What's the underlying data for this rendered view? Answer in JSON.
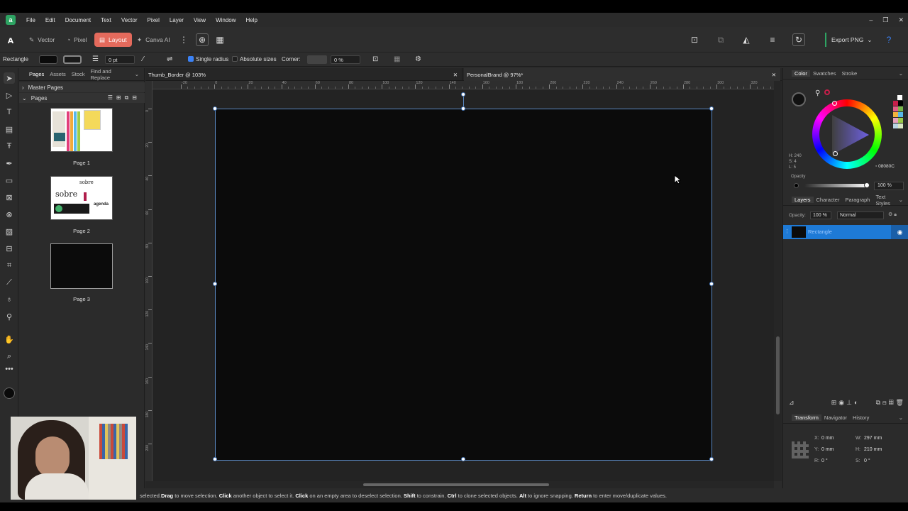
{
  "app": {
    "logo_letter": "a",
    "accent": "#2ea463"
  },
  "menu": [
    "File",
    "Edit",
    "Document",
    "Text",
    "Vector",
    "Pixel",
    "Layer",
    "View",
    "Window",
    "Help"
  ],
  "window_controls": {
    "minimize": "–",
    "restore": "❐",
    "close": "✕"
  },
  "personas": {
    "vector": "Vector",
    "pixel": "Pixel",
    "layout": "Layout",
    "canva": "Canva AI"
  },
  "export_label": "Export PNG",
  "context": {
    "tool_name": "Rectangle",
    "stroke_width": "0 pt",
    "single_radius": "Single radius",
    "absolute_sizes": "Absolute sizes",
    "corner_label": "Corner:",
    "corner_value": "0 %"
  },
  "pages_panel": {
    "tabs": [
      "Pages",
      "Assets",
      "Stock",
      "Find and Replace"
    ],
    "master_pages": "Master Pages",
    "pages_header": "Pages",
    "pages": [
      "Page 1",
      "Page 2",
      "Page 3"
    ],
    "page2_words": {
      "a": "sobre",
      "b": "sobre",
      "c": "agenda"
    }
  },
  "doc_tabs": [
    "Thumb_Border @ 103%",
    "PersonalBrand @ 97%*"
  ],
  "ruler_labels": [
    "-20",
    "0",
    "20",
    "40",
    "60",
    "80",
    "100",
    "120",
    "140",
    "160",
    "180",
    "200",
    "220",
    "240",
    "260",
    "280",
    "300",
    "320"
  ],
  "vruler_labels": [
    "0",
    "20",
    "40",
    "60",
    "80",
    "100",
    "120",
    "140",
    "160",
    "180",
    "200"
  ],
  "color_panel": {
    "tabs": [
      "Color",
      "Swatches",
      "Stroke"
    ],
    "hsl": {
      "h": "H: 240",
      "s": "S: 4",
      "l": "L: 5"
    },
    "hex": "08080C",
    "opacity_label": "Opacity",
    "opacity_value": "100 %"
  },
  "layers_panel": {
    "tabs": [
      "Layers",
      "Character",
      "Paragraph",
      "Text Styles"
    ],
    "opacity_label": "Opacity:",
    "opacity_value": "100 %",
    "blend_mode": "Normal",
    "layer_name": "Rectangle"
  },
  "transform_panel": {
    "tabs": [
      "Transform",
      "Navigator",
      "History"
    ],
    "x_label": "X:",
    "x": "0 mm",
    "y_label": "Y:",
    "y": "0 mm",
    "w_label": "W:",
    "w": "297 mm",
    "h_label": "H:",
    "h": "210 mm",
    "r_label": "R:",
    "r": "0 °",
    "s_label": "S:",
    "s": "0 °"
  },
  "status": {
    "p1": "selected. ",
    "drag": "Drag",
    "p2": " to move selection. ",
    "click": "Click",
    "p3": " another object to select it. ",
    "click2": "Click",
    "p4": " on an empty area to deselect selection. ",
    "shift": "Shift",
    "p5": " to constrain. ",
    "ctrl": "Ctrl",
    "p6": " to clone selected objects. ",
    "alt": "Alt",
    "p7": " to ignore snapping. ",
    "ret": "Return",
    "p8": " to enter move/duplicate values."
  }
}
